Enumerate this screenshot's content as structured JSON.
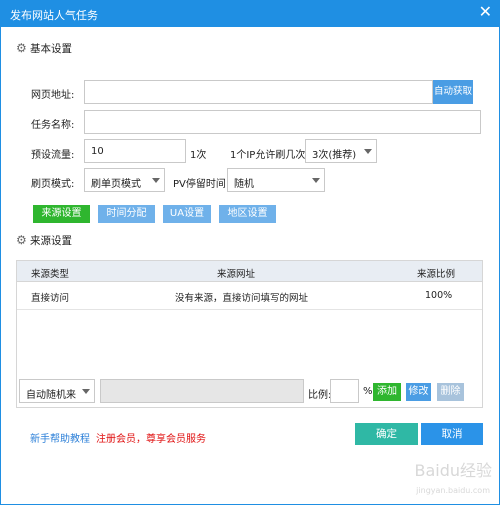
{
  "window": {
    "title": "发布网站人气任务",
    "close_glyph": "✕"
  },
  "basic_section": {
    "title": "基本设置"
  },
  "form": {
    "url_label": "网页地址:",
    "url_value": "",
    "auto_fetch_label": "自动获取",
    "task_name_label": "任务名称:",
    "task_name_value": "",
    "preset_traffic_label": "预设流量:",
    "preset_traffic_value": "10",
    "preset_traffic_unit": "1次",
    "ip_limit_label": "1个IP允许刷几次:",
    "ip_limit_value": "3次(推荐)",
    "mode_label": "刷页模式:",
    "mode_value": "刷单页模式",
    "pv_time_label": "PV停留时间:",
    "pv_time_value": "随机"
  },
  "tabs": [
    {
      "label": "来源设置",
      "active": true
    },
    {
      "label": "时间分配",
      "active": false
    },
    {
      "label": "UA设置",
      "active": false
    },
    {
      "label": "地区设置",
      "active": false
    }
  ],
  "source_section": {
    "title": "来源设置"
  },
  "table": {
    "headers": [
      "来源类型",
      "来源网址",
      "来源比例"
    ],
    "rows": [
      [
        "直接访问",
        "没有来源，直接访问填写的网址",
        "100%"
      ]
    ]
  },
  "source_editor": {
    "type_value": "自动随机来",
    "url_value": "",
    "ratio_label": "比例:",
    "ratio_value": "",
    "percent": "%",
    "add_label": "添加",
    "edit_label": "修改",
    "delete_label": "删除"
  },
  "footer": {
    "help_link": "新手帮助教程",
    "member_link": "注册会员，尊享会员服务",
    "ok_label": "确定",
    "cancel_label": "取消"
  },
  "watermark": {
    "main": "Baidu经验",
    "sub": "jingyan.baidu.com"
  },
  "colors": {
    "titlebar": "#1f8fe3",
    "green": "#2fb62f",
    "ok": "#2fb8a5",
    "cancel": "#2b93e8",
    "member_link": "#e01010",
    "help_link": "#2b7fd8"
  }
}
